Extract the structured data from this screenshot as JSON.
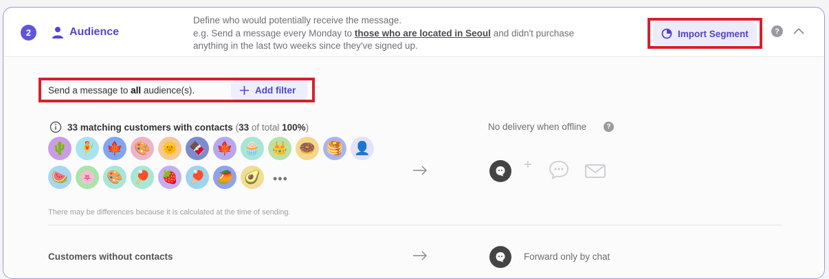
{
  "header": {
    "step_number": "2",
    "title": "Audience",
    "description": {
      "line1": "Define who would potentially receive the message.",
      "line2_prefix": "e.g. Send a message every Monday to ",
      "line2_bold": "those who are located in Seoul",
      "line2_suffix": " and didn't purchase",
      "line3": "anything in the last two weeks since they've signed up."
    },
    "import_label": "Import Segment",
    "help_glyph": "?"
  },
  "filter": {
    "prefix": "Send a message to ",
    "bold": "all",
    "suffix": "  audience(s).",
    "add_filter_label": "Add filter"
  },
  "matching": {
    "headline": "33 matching customers with contacts",
    "open": " (",
    "count": "33",
    "of_total": " of total ",
    "percent": "100%",
    "close": ")"
  },
  "delivery": {
    "no_delivery_text": "No delivery when offline",
    "help_glyph": "?",
    "plus": "+"
  },
  "avatars": {
    "row1": [
      {
        "emoji": "🌵",
        "bg": "#c99be8"
      },
      {
        "emoji": "🧚",
        "bg": "#a8e3f0"
      },
      {
        "emoji": "🍁",
        "bg": "#7fa7f0"
      },
      {
        "emoji": "🎨",
        "bg": "#eeb3c9"
      },
      {
        "emoji": "🌞",
        "bg": "#f5c89a"
      },
      {
        "emoji": "🍫",
        "bg": "#7d8bd1"
      },
      {
        "emoji": "🍁",
        "bg": "#b6a8f0"
      },
      {
        "emoji": "🧁",
        "bg": "#a6e6d6"
      },
      {
        "emoji": "👑",
        "bg": "#b8e2a8"
      },
      {
        "emoji": "🍩",
        "bg": "#f5d78a"
      },
      {
        "emoji": "🥞",
        "bg": "#aab4ec"
      },
      {
        "emoji": "👤",
        "bg": "#e4e2f7"
      }
    ],
    "row2": [
      {
        "emoji": "🍉",
        "bg": "#a8d6f2"
      },
      {
        "emoji": "🌸",
        "bg": "#a6e6a8"
      },
      {
        "emoji": "🎨",
        "bg": "#a8e6da"
      },
      {
        "emoji": "🏓",
        "bg": "#a6e8d4"
      },
      {
        "emoji": "🍓",
        "bg": "#c1b0f2"
      },
      {
        "emoji": "🏓",
        "bg": "#9dd4f0"
      },
      {
        "emoji": "🥭",
        "bg": "#8ea2ee"
      },
      {
        "emoji": "🥑",
        "bg": "#f2dc96"
      }
    ],
    "more": "•••"
  },
  "note": "There may be differences because it is calculated at the time of sending.",
  "without_contacts": {
    "label": "Customers without contacts",
    "forward_text": "Forward only by chat"
  },
  "colors": {
    "accent": "#5147cf",
    "highlight_box": "#d5202b"
  }
}
